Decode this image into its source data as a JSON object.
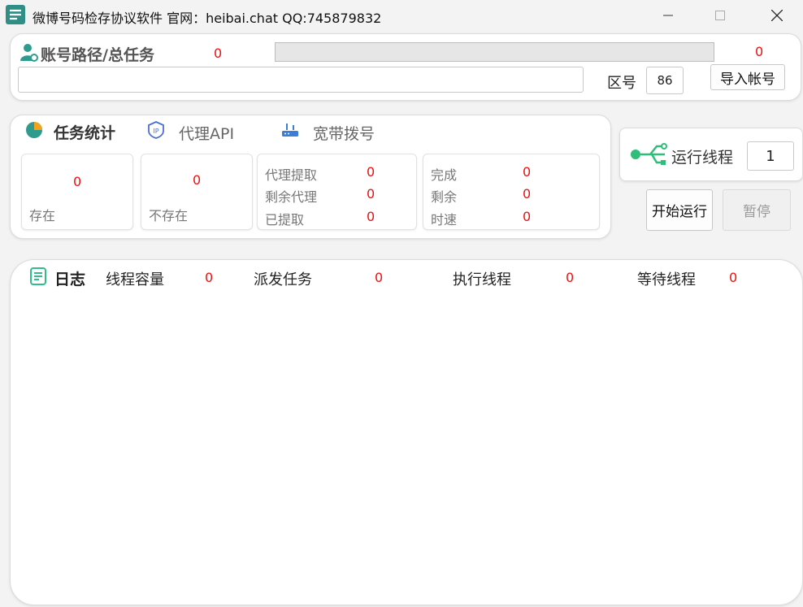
{
  "window": {
    "title": "微博号码检存协议软件 官网：heibai.chat QQ:745879832"
  },
  "account": {
    "label": "账号路径/总任务",
    "total_count": "0",
    "progress_count": "0",
    "progress_fraction": 0,
    "path_value": "",
    "region_label": "区号",
    "region_value": "86",
    "import_button": "导入帐号"
  },
  "tabs": [
    {
      "label": "任务统计",
      "active": true
    },
    {
      "label": "代理API",
      "active": false
    },
    {
      "label": "宽带拨号",
      "active": false
    }
  ],
  "stats": {
    "exist": {
      "value": "0",
      "label": "存在"
    },
    "not_exist": {
      "value": "0",
      "label": "不存在"
    },
    "proxy": [
      {
        "label": "代理提取",
        "value": "0"
      },
      {
        "label": "剩余代理",
        "value": "0"
      },
      {
        "label": "已提取",
        "value": "0"
      }
    ],
    "progress": [
      {
        "label": "完成",
        "value": "0"
      },
      {
        "label": "剩余",
        "value": "0"
      },
      {
        "label": "时速",
        "value": "0"
      }
    ]
  },
  "threads": {
    "label": "运行线程",
    "value": "1",
    "start_button": "开始运行",
    "pause_button": "暂停"
  },
  "log": {
    "title": "日志",
    "items": [
      {
        "label": "线程容量",
        "value": "0"
      },
      {
        "label": "派发任务",
        "value": "0"
      },
      {
        "label": "执行线程",
        "value": "0"
      },
      {
        "label": "等待线程",
        "value": "0"
      }
    ]
  },
  "colors": {
    "accent": "#2f9b8f",
    "red": "#e11111",
    "ip_blue": "#4a6fd6"
  }
}
